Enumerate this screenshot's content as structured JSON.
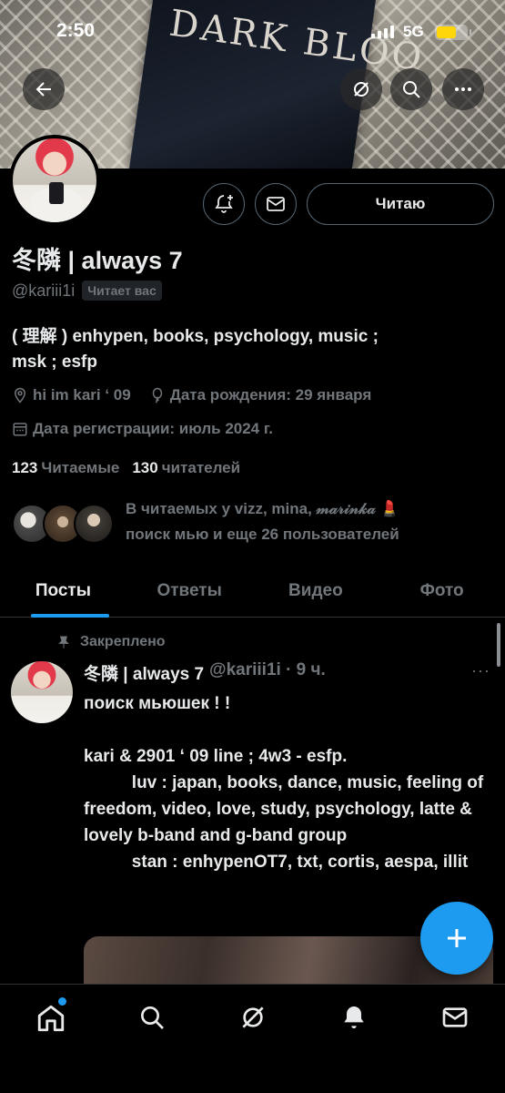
{
  "status_bar": {
    "time": "2:50",
    "network": "5G"
  },
  "banner": {
    "album_text": "DARK BLOO"
  },
  "profile": {
    "follow_button": "Читаю",
    "name": "冬隣 | always 7",
    "handle": "@kariii1i",
    "follows_you": "Читает вас",
    "bio_line1": "( 理解 ) enhypen, books, psychology, music ;",
    "bio_line2": "msk ; esfp",
    "location": "hi im kari ‘ 09",
    "birthday": "Дата рождения: 29 января",
    "joined": "Дата регистрации: июль 2024 г.",
    "following_count": "123",
    "following_label": "Читаемые",
    "followers_count": "130",
    "followers_label": "читателей",
    "known_followers_line1": "В читаемых у vizz, mina, 𝓂𝒶𝓇𝒾𝓃𝓀𝒶 💄",
    "known_followers_line2": "поиск мью и еще 26 пользователей"
  },
  "tabs": [
    {
      "label": "Посты",
      "active": true
    },
    {
      "label": "Ответы",
      "active": false
    },
    {
      "label": "Видео",
      "active": false
    },
    {
      "label": "Фото",
      "active": false
    }
  ],
  "pinned_post": {
    "pinned_label": "Закреплено",
    "author_name": "冬隣 | always 7",
    "author_meta": "@kariii1i · 9 ч.",
    "more": "···",
    "text": "поиск мьюшек ! !\n\nkari & 2901 ‘ 09 line ; 4w3 - esfp.\n          luv : japan, books, dance, music, feeling of freedom, video, love, study, psychology, latte & lovely b-band and g-band group\n          stan : enhypenOT7, txt, cortis, aespa, illit"
  },
  "bottom_nav": [
    "home-icon",
    "search-icon",
    "grok-icon",
    "notifications-icon",
    "messages-icon"
  ],
  "colors": {
    "accent": "#1d9bf0",
    "muted": "#71767b",
    "text": "#e7e9ea",
    "background": "#000000"
  }
}
